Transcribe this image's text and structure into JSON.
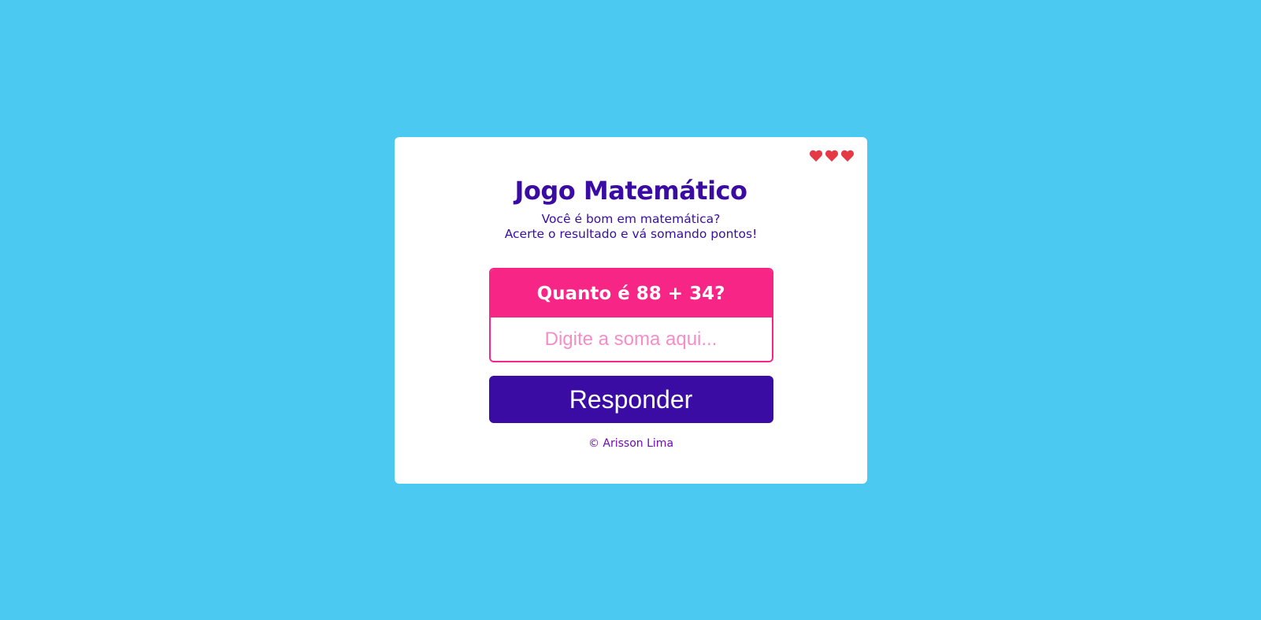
{
  "colors": {
    "background": "#4cc9f0",
    "card": "#ffffff",
    "primary": "#3a0ca3",
    "accent": "#f72585",
    "placeholder": "#f58ec8",
    "footer": "#7209b7",
    "heart": "#e63946"
  },
  "lives": {
    "count": 3,
    "icon": "heart-icon"
  },
  "game": {
    "title": "Jogo Matemático",
    "subtitle_line1": "Você é bom em matemática?",
    "subtitle_line2": "Acerte o resultado e vá somando pontos!",
    "question": "Quanto é 88 + 34?",
    "answer_value": "",
    "answer_placeholder": "Digite a soma aqui...",
    "submit_label": "Responder",
    "footer": "© Arisson Lima"
  }
}
